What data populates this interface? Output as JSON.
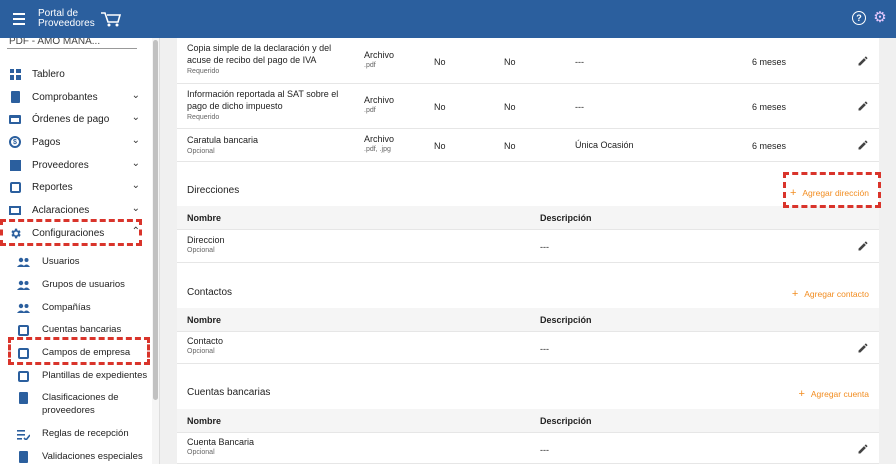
{
  "topbar": {
    "logo_line1": "Portal de",
    "logo_line2": "Proveedores",
    "menu_icon": "hamburger-icon",
    "help_icon": "?",
    "settings_icon": "⚙"
  },
  "sidebar": {
    "select_value": "PDF - AMO MANA...",
    "items": [
      {
        "label": "Tablero"
      },
      {
        "label": "Comprobantes"
      },
      {
        "label": "Órdenes de pago"
      },
      {
        "label": "Pagos"
      },
      {
        "label": "Proveedores"
      },
      {
        "label": "Reportes"
      },
      {
        "label": "Aclaraciones"
      },
      {
        "label": "Configuraciones"
      }
    ],
    "subitems": [
      {
        "label": "Usuarios"
      },
      {
        "label": "Grupos de usuarios"
      },
      {
        "label": "Compañías"
      },
      {
        "label": "Cuentas bancarias"
      },
      {
        "label": "Campos de empresa"
      },
      {
        "label": "Plantillas de expedientes"
      },
      {
        "label": "Clasificaciones de proveedores"
      },
      {
        "label": "Reglas de recepción"
      },
      {
        "label": "Validaciones especiales"
      }
    ],
    "coin_glyph": "$"
  },
  "documents": [
    {
      "name": "Copia simple de la declaración y del acuse de recibo del pago de IVA",
      "req": "Requerido",
      "type": "Archivo",
      "ext": ".pdf",
      "c1": "No",
      "c2": "No",
      "freq": "---",
      "validity": "6 meses"
    },
    {
      "name": "Información reportada al SAT sobre el pago de dicho impuesto",
      "req": "Requerido",
      "type": "Archivo",
      "ext": ".pdf",
      "c1": "No",
      "c2": "No",
      "freq": "---",
      "validity": "6 meses"
    },
    {
      "name": "Caratula bancaria",
      "req": "Opcional",
      "type": "Archivo",
      "ext": ".pdf, .jpg",
      "c1": "No",
      "c2": "No",
      "freq": "Única Ocasión",
      "validity": "6 meses"
    }
  ],
  "sections": {
    "direcciones": {
      "title": "Direcciones",
      "add": "Agregar dirección",
      "col_name": "Nombre",
      "col_desc": "Descripción",
      "row_name": "Direccion",
      "row_req": "Opcional",
      "row_desc": "---"
    },
    "contactos": {
      "title": "Contactos",
      "add": "Agregar contacto",
      "col_name": "Nombre",
      "col_desc": "Descripción",
      "row_name": "Contacto",
      "row_req": "Opcional",
      "row_desc": "---"
    },
    "cuentas": {
      "title": "Cuentas bancarias",
      "add": "Agregar cuenta",
      "col_name": "Nombre",
      "col_desc": "Descripción",
      "row_name": "Cuenta Bancaria",
      "row_req": "Opcional",
      "row_desc": "---"
    }
  },
  "add_glyph": "+",
  "chevron_glyphs": {
    "down": "⌄",
    "up": "⌃"
  },
  "colors": {
    "topbar": "#2b5f9e",
    "accent": "#f28c1f",
    "highlight": "#d9342b"
  }
}
